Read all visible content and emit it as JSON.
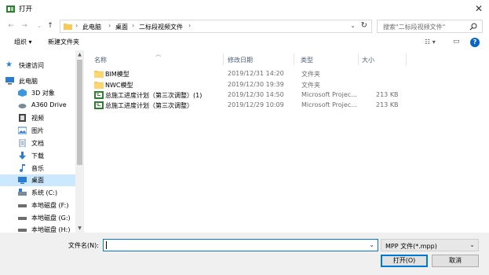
{
  "window": {
    "title": "打开"
  },
  "nav": {
    "breadcrumbs": [
      "此电脑",
      "桌面",
      "二标段视频文件"
    ],
    "search_placeholder": "搜索\"二标段视频文件\""
  },
  "toolbar": {
    "organize_label": "组织 ▾",
    "new_folder_label": "新建文件夹"
  },
  "sidebar": {
    "items": [
      {
        "label": "快速访问",
        "icon": "star-icon"
      },
      {
        "label": "此电脑",
        "icon": "computer-icon"
      },
      {
        "label": "3D 对象",
        "icon": "3d-objects-icon"
      },
      {
        "label": "A360 Drive",
        "icon": "cloud-drive-icon"
      },
      {
        "label": "视频",
        "icon": "video-icon"
      },
      {
        "label": "图片",
        "icon": "pictures-icon"
      },
      {
        "label": "文档",
        "icon": "document-icon"
      },
      {
        "label": "下载",
        "icon": "download-icon"
      },
      {
        "label": "音乐",
        "icon": "music-icon"
      },
      {
        "label": "桌面",
        "icon": "desktop-icon"
      },
      {
        "label": "系统 (C:)",
        "icon": "system-drive-icon"
      },
      {
        "label": "本地磁盘 (F:)",
        "icon": "drive-icon"
      },
      {
        "label": "本地磁盘 (G:)",
        "icon": "drive-icon"
      },
      {
        "label": "本地磁盘 (H:)",
        "icon": "drive-icon"
      }
    ],
    "selected_label": "桌面"
  },
  "filelist": {
    "columns": {
      "name": "名称",
      "date": "修改日期",
      "type": "类型",
      "size": "大小"
    },
    "rows": [
      {
        "name": "BIM模型",
        "date": "2019/12/31 14:20",
        "type": "文件夹",
        "size": "",
        "icon": "folder-icon"
      },
      {
        "name": "NWC模型",
        "date": "2019/12/30 19:39",
        "type": "文件夹",
        "size": "",
        "icon": "folder-icon"
      },
      {
        "name": "总施工进度计划（第三次调整）(1)",
        "date": "2019/12/30 14:50",
        "type": "Microsoft Projec...",
        "size": "213 KB",
        "icon": "mpp-file-icon"
      },
      {
        "name": "总施工进度计划（第三次调整）",
        "date": "2019/12/29 10:09",
        "type": "Microsoft Projec...",
        "size": "213 KB",
        "icon": "mpp-file-icon"
      }
    ]
  },
  "bottom": {
    "filename_label": "文件名(N):",
    "filename_value": "",
    "filetype_selected": "MPP 文件(*.mpp)",
    "open_label": "打开(O)",
    "cancel_label": "取消"
  },
  "colors": {
    "accent": "#0078d7",
    "selection": "#cce8ff",
    "folder": "#f8c959"
  }
}
